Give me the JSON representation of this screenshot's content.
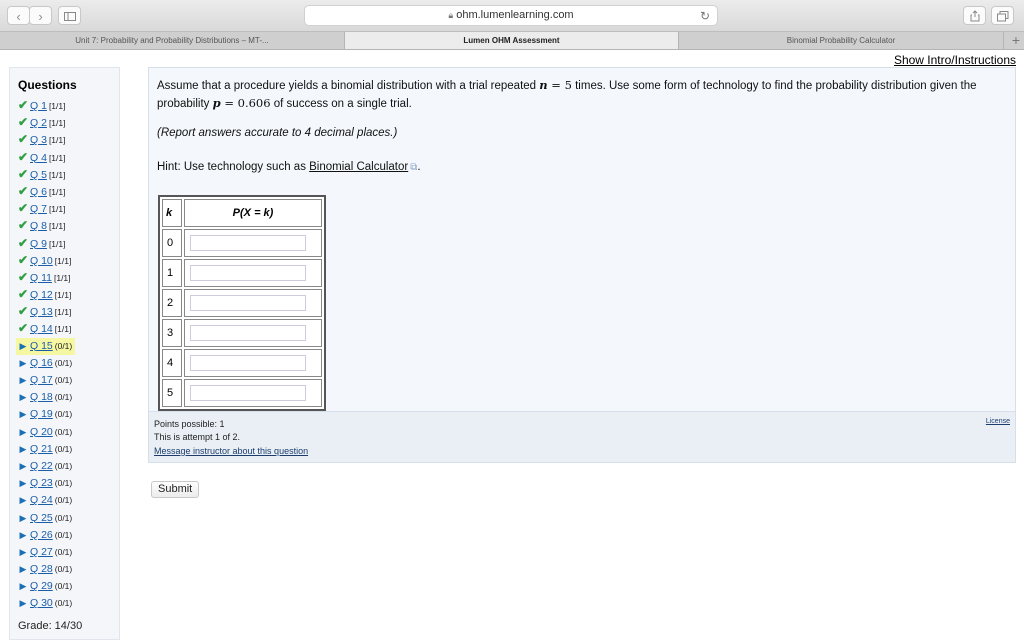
{
  "browser": {
    "url": "ohm.lumenlearning.com",
    "tabs": [
      {
        "label": "Unit 7: Probability and Probability Distributions – MT-...",
        "active": false
      },
      {
        "label": "Lumen OHM Assessment",
        "active": true
      },
      {
        "label": "Binomial Probability Calculator",
        "active": false
      }
    ],
    "new_tab": "+"
  },
  "page": {
    "show_intro": "Show Intro/Instructions"
  },
  "sidebar": {
    "heading": "Questions",
    "questions": [
      {
        "label": "Q 1",
        "score": "[1/1]",
        "status": "correct"
      },
      {
        "label": "Q 2",
        "score": "[1/1]",
        "status": "correct"
      },
      {
        "label": "Q 3",
        "score": "[1/1]",
        "status": "correct"
      },
      {
        "label": "Q 4",
        "score": "[1/1]",
        "status": "correct"
      },
      {
        "label": "Q 5",
        "score": "[1/1]",
        "status": "correct"
      },
      {
        "label": "Q 6",
        "score": "[1/1]",
        "status": "correct"
      },
      {
        "label": "Q 7",
        "score": "[1/1]",
        "status": "correct"
      },
      {
        "label": "Q 8",
        "score": "[1/1]",
        "status": "correct"
      },
      {
        "label": "Q 9",
        "score": "[1/1]",
        "status": "correct"
      },
      {
        "label": "Q 10",
        "score": "[1/1]",
        "status": "correct"
      },
      {
        "label": "Q 11",
        "score": "[1/1]",
        "status": "correct"
      },
      {
        "label": "Q 12",
        "score": "[1/1]",
        "status": "correct"
      },
      {
        "label": "Q 13",
        "score": "[1/1]",
        "status": "correct"
      },
      {
        "label": "Q 14",
        "score": "[1/1]",
        "status": "correct"
      },
      {
        "label": "Q 15",
        "score": "(0/1)",
        "status": "current"
      },
      {
        "label": "Q 16",
        "score": "(0/1)",
        "status": "todo"
      },
      {
        "label": "Q 17",
        "score": "(0/1)",
        "status": "todo"
      },
      {
        "label": "Q 18",
        "score": "(0/1)",
        "status": "todo"
      },
      {
        "label": "Q 19",
        "score": "(0/1)",
        "status": "todo"
      },
      {
        "label": "Q 20",
        "score": "(0/1)",
        "status": "todo"
      },
      {
        "label": "Q 21",
        "score": "(0/1)",
        "status": "todo"
      },
      {
        "label": "Q 22",
        "score": "(0/1)",
        "status": "todo"
      },
      {
        "label": "Q 23",
        "score": "(0/1)",
        "status": "todo"
      },
      {
        "label": "Q 24",
        "score": "(0/1)",
        "status": "todo"
      },
      {
        "label": "Q 25",
        "score": "(0/1)",
        "status": "todo"
      },
      {
        "label": "Q 26",
        "score": "(0/1)",
        "status": "todo"
      },
      {
        "label": "Q 27",
        "score": "(0/1)",
        "status": "todo"
      },
      {
        "label": "Q 28",
        "score": "(0/1)",
        "status": "todo"
      },
      {
        "label": "Q 29",
        "score": "(0/1)",
        "status": "todo"
      },
      {
        "label": "Q 30",
        "score": "(0/1)",
        "status": "todo"
      }
    ],
    "grade": "Grade: 14/30"
  },
  "question": {
    "text_1": "Assume that a procedure yields a binomial distribution with a trial repeated ",
    "n_sym": "n",
    "eq1": " = ",
    "n_val": "5",
    "text_2": " times. Use some form of technology to find the probability distribution given the probability ",
    "p_sym": "p",
    "eq2": " = ",
    "p_val": "0.606",
    "text_3": " of success on a single trial.",
    "report": "(Report answers accurate to 4 decimal places.)",
    "hint_prefix": "Hint: Use technology such as ",
    "hint_link": "Binomial Calculator",
    "hint_suffix": ".",
    "table": {
      "col_k": "k",
      "col_p": "P(X = k)",
      "rows": [
        {
          "k": "0",
          "value": ""
        },
        {
          "k": "1",
          "value": ""
        },
        {
          "k": "2",
          "value": ""
        },
        {
          "k": "3",
          "value": ""
        },
        {
          "k": "4",
          "value": ""
        },
        {
          "k": "5",
          "value": ""
        }
      ]
    }
  },
  "footer": {
    "points": "Points possible: 1",
    "attempt": "This is attempt 1 of 2.",
    "message": "Message instructor about this question",
    "license": "License"
  },
  "submit_label": "Submit",
  "colors": {
    "check": "#2ea043",
    "arrow": "#1a6fb5",
    "current_highlight": "#f6f7a3",
    "link": "#1a5ea8"
  },
  "icons": {
    "back": "chevron-left-icon",
    "forward": "chevron-right-icon",
    "sidebar": "sidebar-icon",
    "lock": "lock-icon",
    "reload": "reload-icon",
    "share": "share-icon",
    "tabs": "tabs-icon",
    "correct": "checkmark-icon",
    "todo": "play-arrow-icon",
    "external": "external-link-icon"
  }
}
